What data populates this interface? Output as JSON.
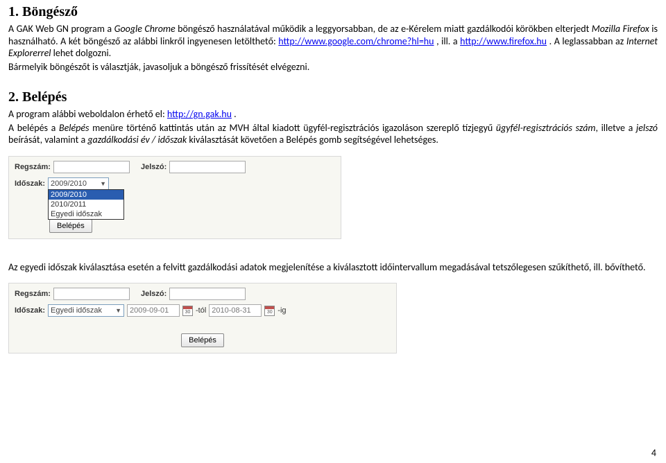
{
  "section1": {
    "title": "1. Böngésző",
    "p1_a": "A GAK Web GN program a ",
    "p1_b": "Google Chrome",
    "p1_c": " böngésző használatával működik a leggyorsabban, de az e-Kérelem miatt gazdálkodói körökben elterjedt ",
    "p1_d": "Mozilla Firefox",
    "p1_e": " is használható. A két böngésző az alábbi linkről ingyenesen letölthető: ",
    "link1": "http://www.google.com/chrome?hl=hu",
    "p1_f": " , ill. a ",
    "link2": "http://www.firefox.hu",
    "p1_g": " . A leglassabban az ",
    "p1_h": "Internet Explorerrel",
    "p1_i": " lehet dolgozni.",
    "p2": "Bármelyik böngészőt is választják, javasoljuk a böngésző frissítését elvégezni."
  },
  "section2": {
    "title": "2. Belépés",
    "p1_a": "A program alábbi weboldalon érhető el: ",
    "link1": "http://gn.gak.hu",
    "p1_b": " .",
    "p2_a": "A belépés a ",
    "p2_b": "Belépés",
    "p2_c": " menüre történő kattintás után az MVH által kiadott ügyfél-regisztrációs igazoláson szereplő tízjegyű ",
    "p2_d": "ügyfél-regisztrációs szám",
    "p2_e": ", illetve a ",
    "p2_f": "jelszó",
    "p2_g": " beírását, valamint a ",
    "p2_h": "gazdálkodási év / időszak",
    "p2_i": " kiválasztását követően a Belépés gomb segítségével lehetséges."
  },
  "form1": {
    "regszam_label": "Regszám:",
    "jelszo_label": "Jelszó:",
    "idoszak_label": "Időszak:",
    "selected": "2009/2010",
    "opt1": "2009/2010",
    "opt2": "2010/2011",
    "opt3": "Egyedi időszak",
    "login_btn": "Belépés"
  },
  "mid_para": "Az egyedi időszak kiválasztása esetén a felvitt gazdálkodási adatok megjelenítése a kiválasztott időintervallum megadásával tetszőlegesen szűkíthető, ill. bővíthető.",
  "form2": {
    "regszam_label": "Regszám:",
    "jelszo_label": "Jelszó:",
    "idoszak_label": "Időszak:",
    "idoszak_value": "Egyedi időszak",
    "date_from": "2009-09-01",
    "date_from_suffix": "-tól",
    "date_to": "2010-08-31",
    "date_to_suffix": "-ig",
    "login_btn": "Belépés"
  },
  "page_number": "4"
}
